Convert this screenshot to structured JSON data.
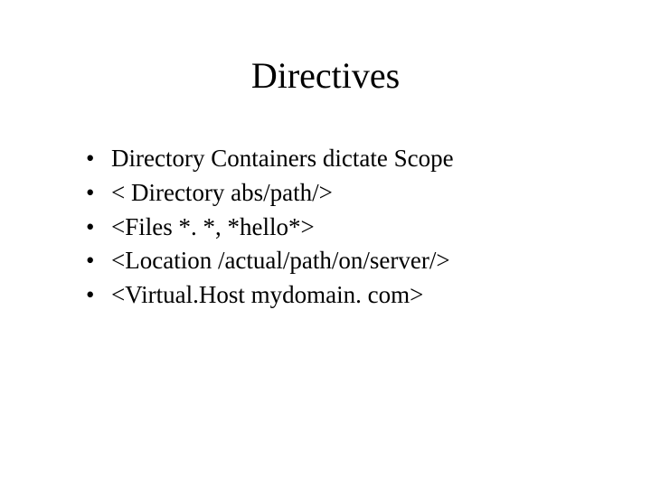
{
  "title": "Directives",
  "bullets": [
    "Directory Containers dictate Scope",
    "< Directory abs/path/>",
    "<Files *. *, *hello*>",
    "<Location /actual/path/on/server/>",
    "<Virtual.Host mydomain. com>"
  ]
}
